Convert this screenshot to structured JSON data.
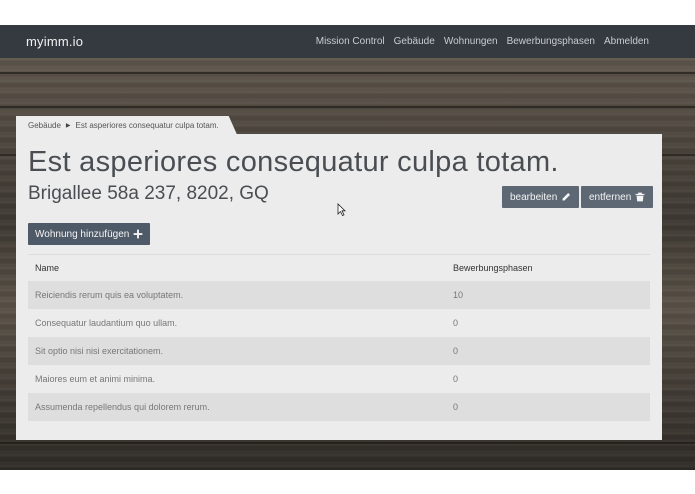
{
  "navbar": {
    "brand": "myimm.io",
    "links": [
      "Mission Control",
      "Gebäude",
      "Wohnungen",
      "Bewerbungsphasen",
      "Abmelden"
    ]
  },
  "breadcrumb": {
    "parent": "Gebäude",
    "current": "Est asperiores consequatur culpa totam."
  },
  "building": {
    "title": "Est asperiores consequatur culpa totam.",
    "address": "Brigallee 58a 237, 8202, GQ"
  },
  "actions": {
    "edit_label": "bearbeiten",
    "remove_label": "entfernen",
    "add_label": "Wohnung hinzufügen"
  },
  "table": {
    "headers": [
      "Name",
      "Bewerbungsphasen"
    ],
    "rows": [
      {
        "name": "Reiciendis rerum quis ea voluptatem.",
        "phases": "10"
      },
      {
        "name": "Consequatur laudantium quo ullam.",
        "phases": "0"
      },
      {
        "name": "Sit optio nisi nisi exercitationem.",
        "phases": "0"
      },
      {
        "name": "Maiores eum et animi minima.",
        "phases": "0"
      },
      {
        "name": "Assumenda repellendus qui dolorem rerum.",
        "phases": "0"
      }
    ]
  },
  "icons": {
    "edit": "pencil-icon",
    "remove": "trash-icon",
    "add": "plus-icon",
    "breadcrumb_separator": "caret-right-icon"
  }
}
